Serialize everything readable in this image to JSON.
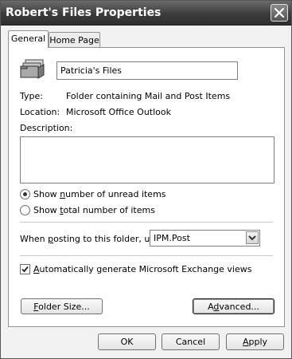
{
  "window": {
    "title": "Robert's Files Properties"
  },
  "tabs": [
    {
      "label": "General",
      "active": true
    },
    {
      "label": "Home Page",
      "active": false
    }
  ],
  "general": {
    "folder_icon": "folder-stack-icon",
    "folder_name": "Patricia's Files",
    "type_label": "Type:",
    "type_value": "Folder containing Mail and Post Items",
    "location_label": "Location:",
    "location_value": "Microsoft Office Outlook",
    "description_label": "Description:",
    "description_value": "",
    "radio_unread": {
      "pre": "Show ",
      "key": "n",
      "post": "umber of unread items",
      "selected": true
    },
    "radio_total": {
      "pre": "Show ",
      "key": "t",
      "post": "otal number of items",
      "selected": false
    },
    "posting_label": {
      "pre": "When ",
      "key": "p",
      "post": "osting to this folder, use:"
    },
    "posting_value": "IPM.Post",
    "auto_views": {
      "pre": "",
      "key": "A",
      "post": "utomatically generate Microsoft Exchange views",
      "checked": true
    },
    "folder_size_btn": {
      "pre": "",
      "key": "F",
      "post": "older Size..."
    },
    "advanced_btn": {
      "pre": "A",
      "key": "d",
      "post": "vanced..."
    }
  },
  "footer": {
    "ok": "OK",
    "cancel": "Cancel",
    "apply": {
      "pre": "",
      "key": "A",
      "post": "pply"
    }
  }
}
